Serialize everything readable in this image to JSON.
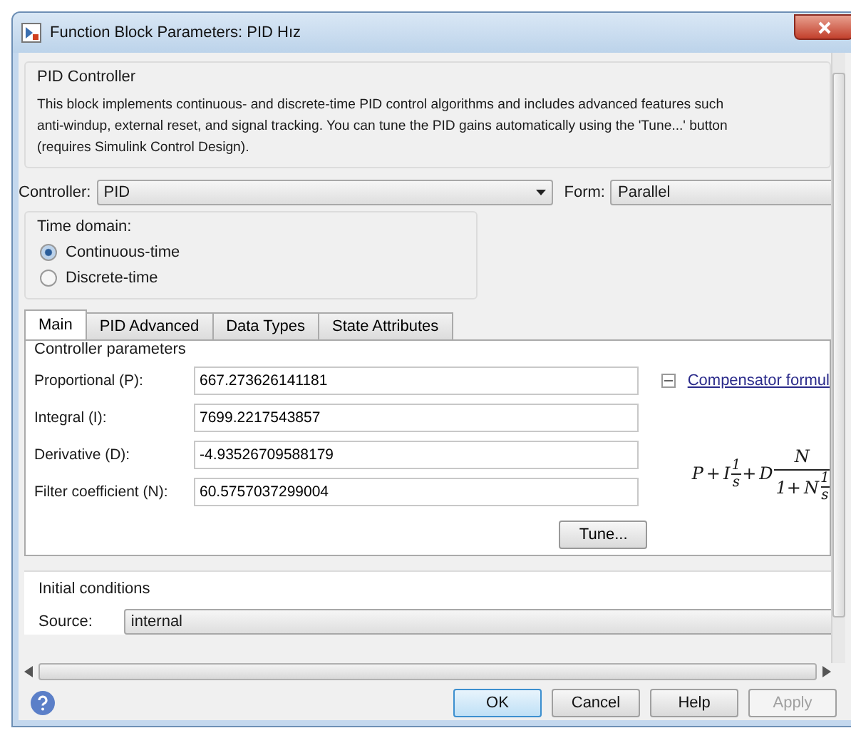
{
  "window": {
    "title": "Function Block Parameters: PID Hız"
  },
  "block": {
    "title": "PID Controller",
    "description": [
      "This block implements continuous- and discrete-time PID control algorithms and includes advanced features such",
      "anti-windup, external reset, and signal tracking. You can tune the PID gains automatically using the 'Tune...' button",
      "(requires Simulink Control Design)."
    ]
  },
  "controller": {
    "label": "Controller:",
    "value": "PID"
  },
  "form": {
    "label": "Form:",
    "value": "Parallel"
  },
  "time_domain": {
    "title": "Time domain:",
    "options": [
      {
        "label": "Continuous-time",
        "selected": true
      },
      {
        "label": "Discrete-time",
        "selected": false
      }
    ]
  },
  "tabs": [
    {
      "label": "Main",
      "selected": true
    },
    {
      "label": "PID Advanced",
      "selected": false
    },
    {
      "label": "Data Types",
      "selected": false
    },
    {
      "label": "State Attributes",
      "selected": false
    }
  ],
  "parameters": {
    "title": "Controller parameters",
    "fields": [
      {
        "label": "Proportional (P):",
        "value": "667.273626141181"
      },
      {
        "label": "Integral (I):",
        "value": "7699.2217543857"
      },
      {
        "label": "Derivative (D):",
        "value": "-4.93526709588179"
      },
      {
        "label": "Filter coefficient (N):",
        "value": "60.5757037299004"
      }
    ],
    "tune": "Tune...",
    "formula_link": {
      "label": "Compensator formul",
      "expanded": true
    },
    "formula": [
      {
        "kind": "sym",
        "text": "P"
      },
      {
        "kind": "sym",
        "text": "+"
      },
      {
        "kind": "sym",
        "text": "I"
      },
      {
        "kind": "frac",
        "num": "1",
        "den": "s"
      },
      {
        "kind": "sym",
        "text": "+"
      },
      {
        "kind": "sym",
        "text": "D"
      },
      {
        "kind": "bigfrac",
        "num": "N",
        "den": [
          {
            "kind": "sym",
            "text": "1+"
          },
          {
            "kind": "sym",
            "text": "N"
          },
          {
            "kind": "frac",
            "num": "1",
            "den": "s"
          }
        ]
      }
    ]
  },
  "initial_conditions": {
    "title": "Initial conditions",
    "source_label": "Source:",
    "source_value": "internal"
  },
  "buttons": [
    {
      "label": "OK",
      "default": true,
      "disabled": false
    },
    {
      "label": "Cancel",
      "default": false,
      "disabled": false
    },
    {
      "label": "Help",
      "default": false,
      "disabled": false
    },
    {
      "label": "Apply",
      "default": false,
      "disabled": true
    }
  ]
}
